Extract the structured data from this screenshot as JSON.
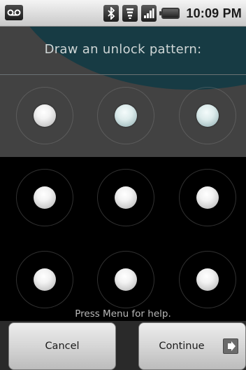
{
  "status_bar": {
    "time": "10:09 PM",
    "icons": [
      "voicemail-icon",
      "bluetooth-icon",
      "wifi-icon",
      "signal-icon",
      "battery-icon"
    ]
  },
  "pattern_screen": {
    "title": "Draw an unlock pattern:",
    "help": "Press Menu for help.",
    "grid": {
      "rows": 3,
      "cols": 3
    }
  },
  "buttons": {
    "cancel_label": "Cancel",
    "continue_label": "Continue"
  },
  "colors": {
    "accent_teal": "#173b44",
    "panel_gray": "#424242",
    "background": "#000000"
  }
}
